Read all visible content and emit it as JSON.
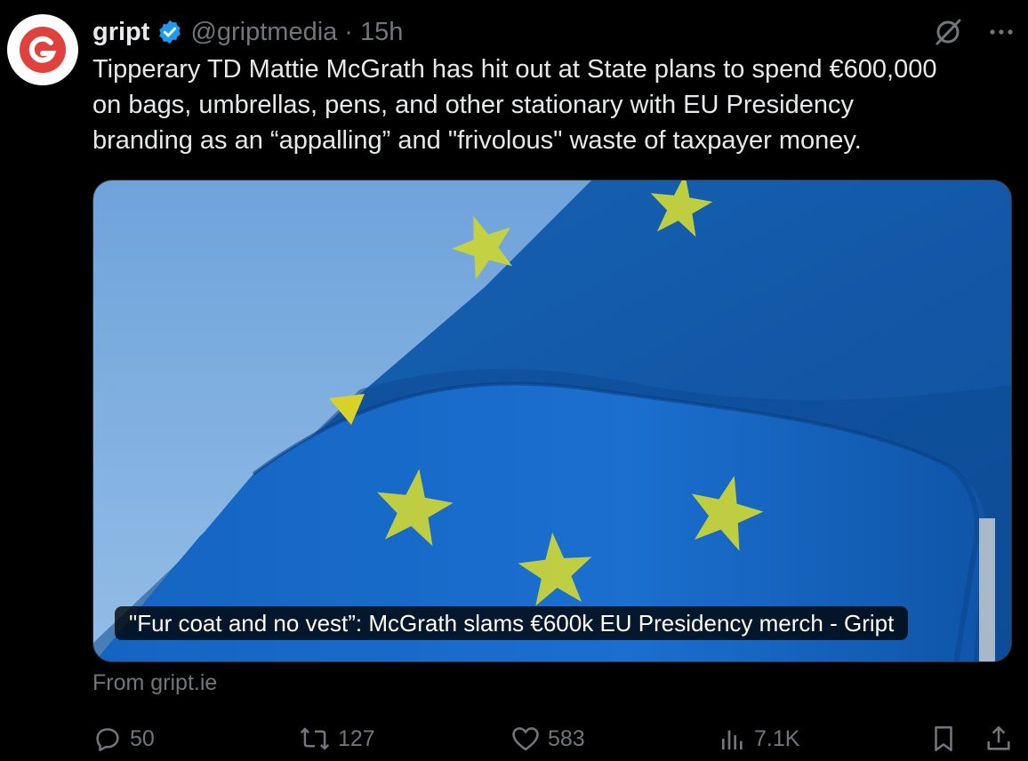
{
  "tweet": {
    "display_name": "gript",
    "handle": "@griptmedia",
    "separator": "·",
    "time": "15h",
    "text": "Tipperary TD Mattie McGrath has hit out at State plans to spend €600,000\non bags, umbrellas, pens, and other stationary with EU Presidency\nbranding as an “appalling” and \"frivolous\" waste of taxpayer money.",
    "avatar_icon": "gript-logo",
    "header_icons": [
      "verified-badge-icon",
      "grok-icon",
      "more-icon"
    ]
  },
  "card": {
    "caption": "\"Fur coat and no vest”: McGrath slams €600k EU Presidency merch - Gript",
    "image": "eu-flag-photo",
    "source": "From gript.ie"
  },
  "actions": {
    "reply_count": "50",
    "repost_count": "127",
    "like_count": "583",
    "views_count": "7.1K",
    "icons": [
      "reply-icon",
      "repost-icon",
      "like-icon",
      "views-icon",
      "bookmark-icon",
      "share-icon"
    ]
  },
  "colors": {
    "background": "#000000",
    "text_primary": "#e7e9ea",
    "text_secondary": "#71767b",
    "verified": "#1d9bf0",
    "logo_red": "#e0413d",
    "flag_blue": "#1565c0",
    "star_yellow": "#d4d52a"
  }
}
